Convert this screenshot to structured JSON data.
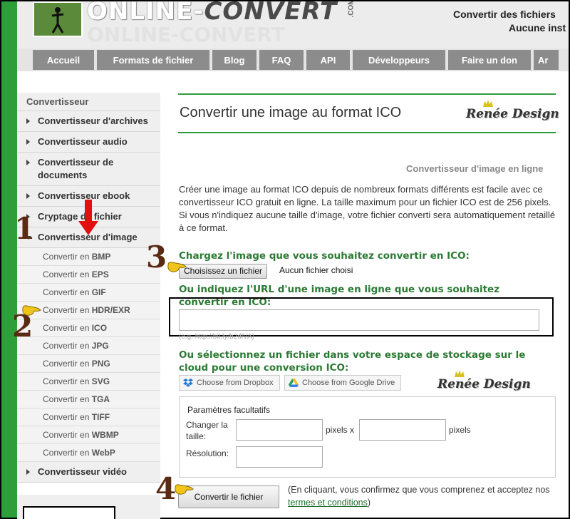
{
  "header": {
    "logo_part1": "ONLINE-",
    "logo_part2": "CONVERT",
    "logo_com": ".COM",
    "tagline1": "Convertir des fichiers",
    "tagline2": "Aucune inst"
  },
  "nav": {
    "items": [
      {
        "label": "Accueil"
      },
      {
        "label": "Formats de fichier"
      },
      {
        "label": "Blog"
      },
      {
        "label": "FAQ"
      },
      {
        "label": "API"
      },
      {
        "label": "Développeurs"
      },
      {
        "label": "Faire un don"
      },
      {
        "label": "Ar"
      }
    ]
  },
  "sidebar": {
    "title": "Convertisseur",
    "items": [
      {
        "label": "Convertisseur d'archives"
      },
      {
        "label": "Convertisseur audio"
      },
      {
        "label": "Convertisseur de documents"
      },
      {
        "label": "Convertisseur ebook"
      },
      {
        "label": "Cryptage de fichier"
      },
      {
        "label": "Convertisseur d'image"
      }
    ],
    "sub_prefix": "Convertir en",
    "subitems": [
      "BMP",
      "EPS",
      "GIF",
      "HDR/EXR",
      "ICO",
      "JPG",
      "PNG",
      "SVG",
      "TGA",
      "TIFF",
      "WBMP",
      "WebP"
    ],
    "last_item": "Convertisseur vidéo"
  },
  "main": {
    "title": "Convertir une image au format ICO",
    "subtitle": "Convertisseur d'image en ligne",
    "description": "Créer une image au format ICO depuis de nombreux formats différents est facile avec ce convertisseur ICO gratuit en ligne. La taille maximum pour un fichier ICO est de 256 pixels. Si vous n'indiquez aucune taille d'image, votre fichier converti sera automatiquement retaillé à ce format.",
    "upload_label": "Chargez l'image que vous souhaitez convertir en ICO:",
    "file_button": "Choisissez un fichier",
    "no_file": "Aucun fichier choisi",
    "url_label": "Ou indiquez l'URL d'une image en ligne que vous souhaitez convertir en ICO:",
    "url_value": "",
    "url_hint": "(e.g. http://bit.ly/b2dlVA)",
    "cloud_label": "Ou sélectionnez un fichier dans votre espace de stockage sur le cloud pour une conversion ICO:",
    "dropbox_button": "Choose from Dropbox",
    "gdrive_button": "Choose from Google Drive",
    "options": {
      "title": "Paramètres facultatifs",
      "size_label": "Changer la taille:",
      "width_value": "",
      "height_value": "",
      "unit1": "pixels x",
      "unit2": "pixels",
      "dpi_label": "Résolution:",
      "dpi_value": ""
    },
    "convert_button": "Convertir le fichier",
    "confirm_text": "(En cliquant, vous confirmez que vous comprenez et acceptez nos ",
    "terms_link": "termes et conditions",
    "confirm_end": ")"
  },
  "annotations": {
    "watermark": "Renée Design",
    "step1": "1",
    "step2": "2",
    "step3": "3",
    "step4": "4"
  },
  "colors": {
    "accent_green": "#2e9e3a",
    "label_green": "#2b7a34",
    "nav_grey": "#8c8c8c",
    "annotation_brown": "#5a2a12",
    "arrow_red": "#e01010"
  }
}
